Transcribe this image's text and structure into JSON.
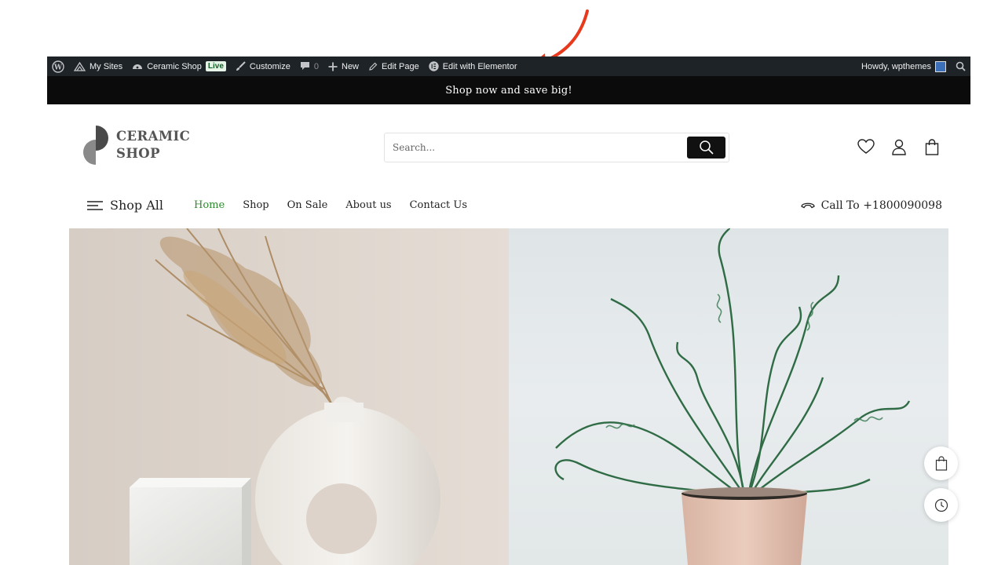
{
  "admin_bar": {
    "my_sites": "My Sites",
    "site_name": "Ceramic Shop",
    "live_badge": "Live",
    "customize": "Customize",
    "comments_count": "0",
    "new": "New",
    "edit_page": "Edit Page",
    "edit_elementor": "Edit with Elementor",
    "howdy": "Howdy, wpthemes"
  },
  "notice": {
    "text": "Shop now and save big!"
  },
  "logo": {
    "line1": "CERAMIC",
    "line2": "SHOP"
  },
  "search": {
    "placeholder": "Search..."
  },
  "nav": {
    "shop_all": "Shop All",
    "items": [
      {
        "label": "Home",
        "active": true
      },
      {
        "label": "Shop"
      },
      {
        "label": "On Sale"
      },
      {
        "label": "About us"
      },
      {
        "label": "Contact Us"
      }
    ],
    "call": "Call To +1800090098"
  },
  "colors": {
    "admin_bar_bg": "#1d2327",
    "notice_bg": "#0b0b0b",
    "accent_green": "#2e8b2e",
    "annotation_red": "#e8391c"
  },
  "icons": {
    "header": [
      "heart-icon",
      "user-icon",
      "shopping-bag-icon"
    ],
    "floating": [
      "cart-icon",
      "clock-icon"
    ]
  }
}
